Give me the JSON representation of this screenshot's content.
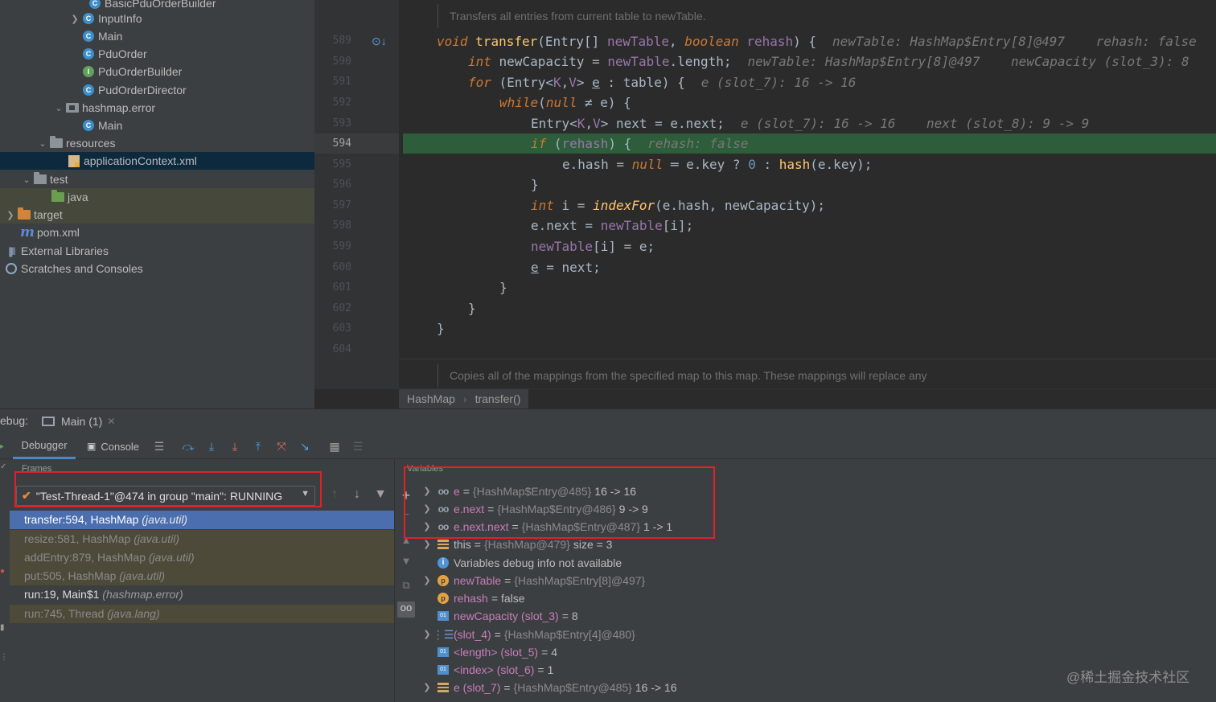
{
  "project_tree": {
    "items": [
      {
        "label": "BasicPduOrderBuilder",
        "icon": "class-icon"
      },
      {
        "label": "InputInfo",
        "icon": "class-icon"
      },
      {
        "label": "Main",
        "icon": "class-icon"
      },
      {
        "label": "PduOrder",
        "icon": "class-icon"
      },
      {
        "label": "PduOrderBuilder",
        "icon": "interface-icon"
      },
      {
        "label": "PudOrderDirector",
        "icon": "class-icon"
      },
      {
        "label": "hashmap.error",
        "icon": "package-icon"
      },
      {
        "label": "Main",
        "icon": "class-icon"
      },
      {
        "label": "resources",
        "icon": "folder-icon"
      },
      {
        "label": "applicationContext.xml",
        "icon": "xml-file-icon"
      },
      {
        "label": "test",
        "icon": "folder-icon"
      },
      {
        "label": "java",
        "icon": "green-folder-icon"
      },
      {
        "label": "target",
        "icon": "orange-folder-icon"
      },
      {
        "label": "pom.xml",
        "icon": "maven-icon"
      },
      {
        "label": "External Libraries",
        "icon": "libraries-icon"
      },
      {
        "label": "Scratches and Consoles",
        "icon": "scratches-icon"
      }
    ]
  },
  "editor": {
    "doc_top": "Transfers all entries from current table to newTable.",
    "doc_bottom": "Copies all of the mappings from the specified map to this map. These mappings will replace any",
    "line_numbers": [
      "589",
      "590",
      "591",
      "592",
      "593",
      "594",
      "595",
      "596",
      "597",
      "598",
      "599",
      "600",
      "601",
      "602",
      "603",
      "604"
    ],
    "current_line": "594",
    "hints": {
      "l589": "newTable: HashMap$Entry[8]@497    rehash: false",
      "l590": "newTable: HashMap$Entry[8]@497    newCapacity (slot_3): 8",
      "l591": "e (slot_7): 16 -> 16",
      "l593": "e (slot_7): 16 -> 16    next (slot_8): 9 -> 9",
      "l594": "rehash: false"
    },
    "breadcrumb": [
      "HashMap",
      "transfer()"
    ]
  },
  "debug": {
    "label": "ebug:",
    "session_tab": "Main (1)",
    "tabs": {
      "debugger": "Debugger",
      "console": "Console"
    },
    "frames_label": "Frames",
    "thread": "\"Test-Thread-1\"@474 in group \"main\": RUNNING",
    "frames": [
      {
        "method": "transfer:594, HashMap",
        "pkg": "(java.util)"
      },
      {
        "method": "resize:581, HashMap",
        "pkg": "(java.util)"
      },
      {
        "method": "addEntry:879, HashMap",
        "pkg": "(java.util)"
      },
      {
        "method": "put:505, HashMap",
        "pkg": "(java.util)"
      },
      {
        "method": "run:19, Main$1",
        "pkg": "(hashmap.error)"
      },
      {
        "method": "run:745, Thread",
        "pkg": "(java.lang)"
      }
    ],
    "variables_label": "Variables",
    "variables": [
      {
        "name": "e",
        "ref": "{HashMap$Entry@485}",
        "value": "16 -> 16",
        "icon": "watch-icon"
      },
      {
        "name": "e.next",
        "ref": "{HashMap$Entry@486}",
        "value": "9 -> 9",
        "icon": "watch-icon"
      },
      {
        "name": "e.next.next",
        "ref": "{HashMap$Entry@487}",
        "value": "1 -> 1",
        "icon": "watch-icon"
      },
      {
        "name": "this",
        "ref": "{HashMap@479}",
        "value": "size = 3",
        "icon": "field-icon"
      },
      {
        "name": "Variables debug info not available",
        "ref": "",
        "value": "",
        "icon": "info-icon"
      },
      {
        "name": "newTable",
        "ref": "{HashMap$Entry[8]@497}",
        "value": "",
        "icon": "parameter-icon"
      },
      {
        "name": "rehash",
        "ref": "",
        "value": "false",
        "icon": "parameter-icon"
      },
      {
        "name": "newCapacity (slot_3)",
        "ref": "",
        "value": "8",
        "icon": "primitive-icon"
      },
      {
        "name": "(slot_4)",
        "ref": "{HashMap$Entry[4]@480}",
        "value": "",
        "icon": "array-icon"
      },
      {
        "name": "<length> (slot_5)",
        "ref": "",
        "value": "4",
        "icon": "primitive-icon"
      },
      {
        "name": "<index> (slot_6)",
        "ref": "",
        "value": "1",
        "icon": "primitive-icon"
      },
      {
        "name": "e (slot_7)",
        "ref": "{HashMap$Entry@485}",
        "value": "16 -> 16",
        "icon": "array-icon"
      }
    ]
  },
  "watermark": "@稀土掘金技术社区",
  "colors": {
    "highlight_line": "#2d5d3a",
    "selected_frame": "#4b6eaf",
    "annotation_box": "#e0202a",
    "keyword": "#cc7832",
    "method": "#ffc66d",
    "field": "#9876aa"
  }
}
